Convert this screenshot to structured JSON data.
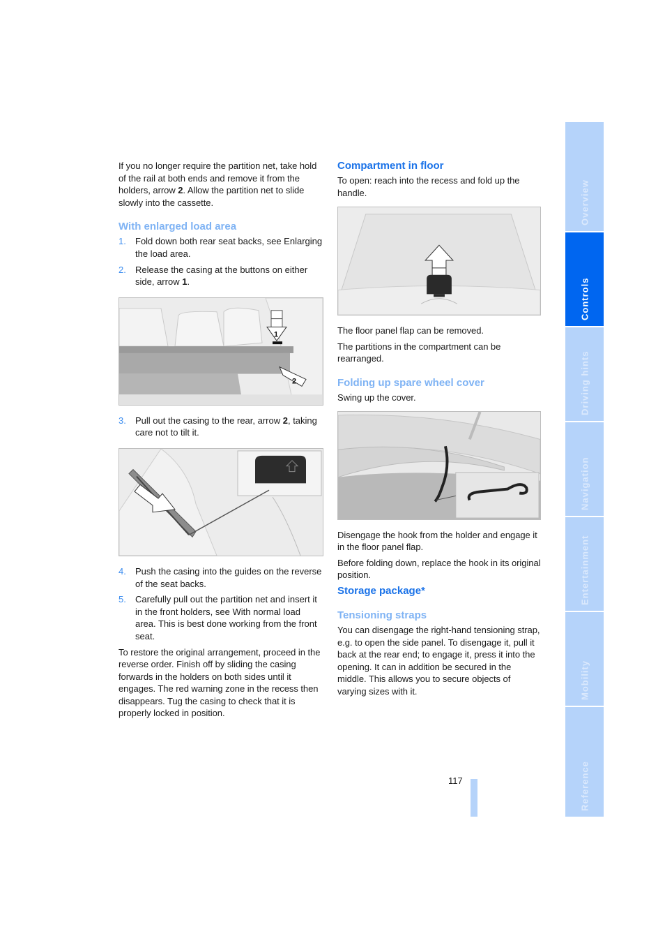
{
  "left_column": {
    "intro_paragraph": {
      "pre": "If you no longer require the partition net, take hold of the rail at both ends and remove it from the holders, arrow ",
      "bold": "2",
      "post": ". Allow the partition net to slide slowly into the cassette."
    },
    "section_heading": "With enlarged load area",
    "steps_a": [
      {
        "number": "1.",
        "text": "Fold down both rear seat backs, see Enlarging the load area."
      },
      {
        "number": "2.",
        "pre": "Release the casing at the buttons on either side, arrow ",
        "bold": "1",
        "post": "."
      }
    ],
    "figure_1": {
      "alt": "Rear seat casing with arrow 1 pressing release button and arrow 2 pulling out",
      "arrow_labels": [
        "1",
        "2"
      ]
    },
    "step_3": {
      "number": "3.",
      "pre": "Pull out the casing to the rear, arrow ",
      "bold": "2",
      "post": ", taking care not to tilt it."
    },
    "figure_2": {
      "alt": "Casing being pushed into seat back guides with inset of release button"
    },
    "steps_b": [
      {
        "number": "4.",
        "text": "Push the casing into the guides on the reverse of the seat backs."
      },
      {
        "number": "5.",
        "text": "Carefully pull out the partition net and insert it in the front holders, see With normal load area. This is best done working from the front seat."
      }
    ],
    "closing_paragraph": "To restore the original arrangement, proceed in the reverse order. Finish off by sliding the casing forwards in the holders on both sides until it engages. The red warning zone in the recess then disappears. Tug the casing to check that it is properly locked in position."
  },
  "right_column": {
    "compartment_heading": "Compartment in floor",
    "compartment_text": "To open: reach into the recess and fold up the handle.",
    "figure_3": {
      "alt": "Cargo floor with handle and upward arrow"
    },
    "flap_text": "The floor panel flap can be removed.",
    "partitions_text": "The partitions in the compartment can be rearranged.",
    "spare_wheel_heading": "Folding up spare wheel cover",
    "spare_wheel_text": "Swing up the cover.",
    "figure_4": {
      "alt": "Spare wheel cover raised with strap and inset of hook"
    },
    "hook_text": "Disengage the hook from the holder and engage it in the floor panel flap.",
    "replace_text": "Before folding down, replace the hook in its original position.",
    "storage_heading": "Storage package*",
    "straps_heading": "Tensioning straps",
    "straps_text": "You can disengage the right-hand tensioning strap, e.g. to open the side panel. To disengage it, pull it back at the rear end; to engage it, press it into the opening. It can in addition be secured in the middle. This allows you to secure objects of varying sizes with it."
  },
  "sidebar": {
    "active_color": "#0066f0",
    "inactive_color": "#b5d3fa",
    "tabs": [
      {
        "label": "Overview",
        "active": false
      },
      {
        "label": "Controls",
        "active": true
      },
      {
        "label": "Driving hints",
        "active": false
      },
      {
        "label": "Navigation",
        "active": false
      },
      {
        "label": "Entertainment",
        "active": false
      },
      {
        "label": "Mobility",
        "active": false
      },
      {
        "label": "Reference",
        "active": false
      }
    ]
  },
  "footer": {
    "page_number": "117"
  },
  "colors": {
    "heading_primary": "#1a72e8",
    "heading_secondary": "#7fb3f4",
    "list_number": "#3d8ef0"
  }
}
